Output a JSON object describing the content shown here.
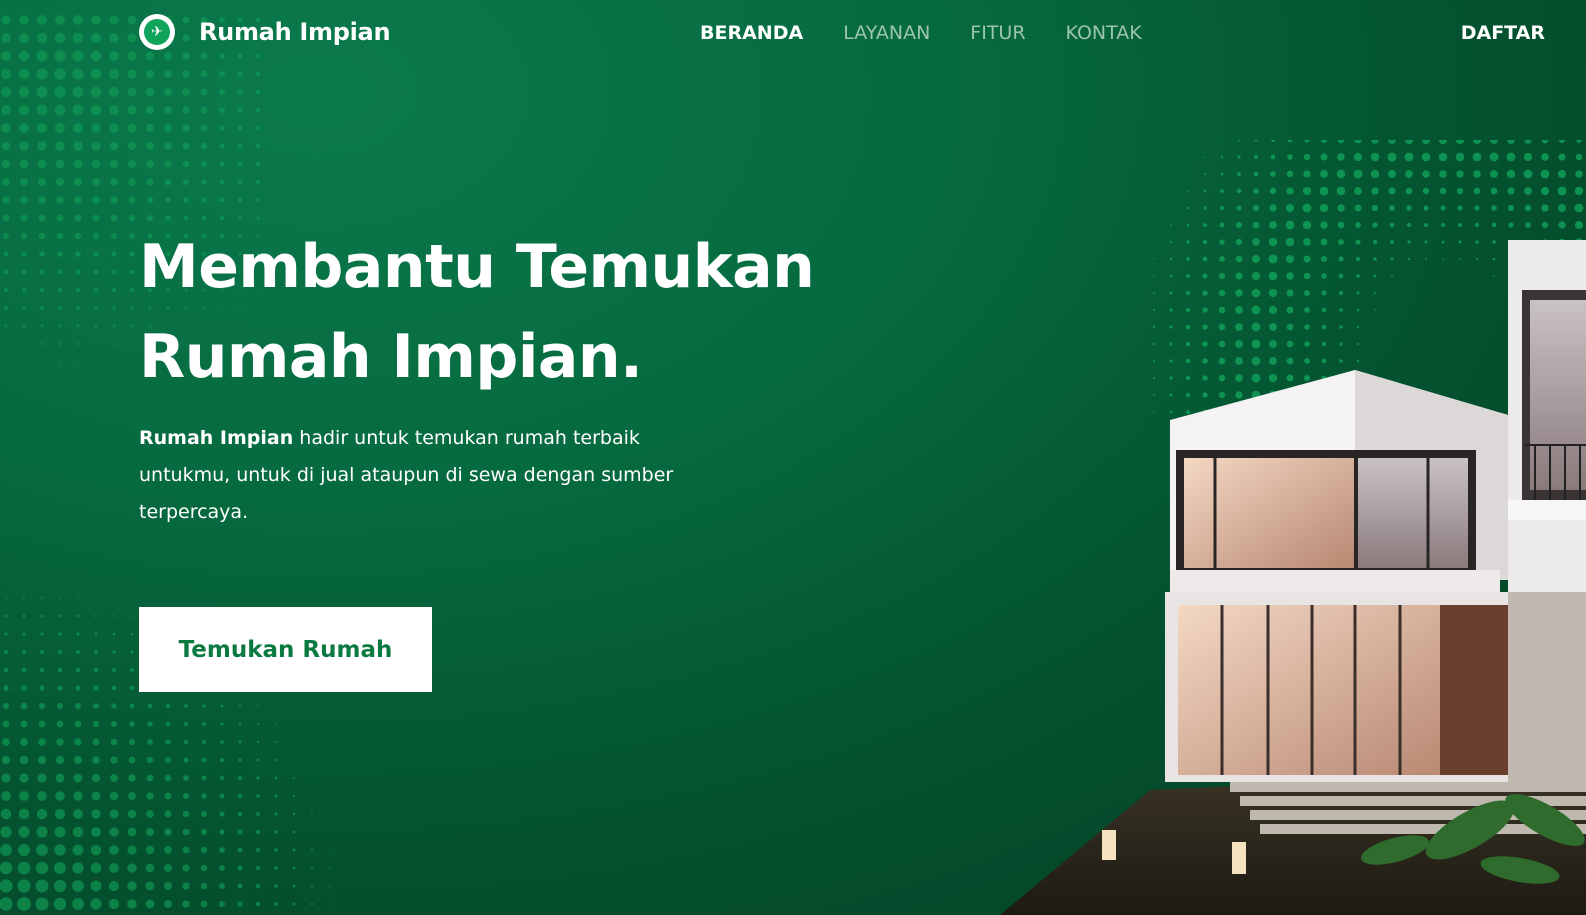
{
  "nav": {
    "brand": "Rumah Impian",
    "logo_icon": "plane-icon",
    "items": [
      {
        "label": "BERANDA",
        "active": true
      },
      {
        "label": "LAYANAN",
        "active": false
      },
      {
        "label": "FITUR",
        "active": false
      },
      {
        "label": "KONTAK",
        "active": false
      }
    ],
    "register_label": "DAFTAR"
  },
  "hero": {
    "headline_line1": "Membantu Temukan",
    "headline_line2": "Rumah Impian.",
    "description_bold": "Rumah Impian",
    "description_rest": " hadir untuk temukan rumah terbaik untukmu, untuk di jual ataupun di sewa dengan sumber terpercaya.",
    "cta_label": "Temukan Rumah"
  },
  "colors": {
    "background": "#056a3e",
    "accent": "#0b7a40",
    "nav_inactive": "#9cc4ae",
    "dot_pattern": "#12a35a"
  }
}
